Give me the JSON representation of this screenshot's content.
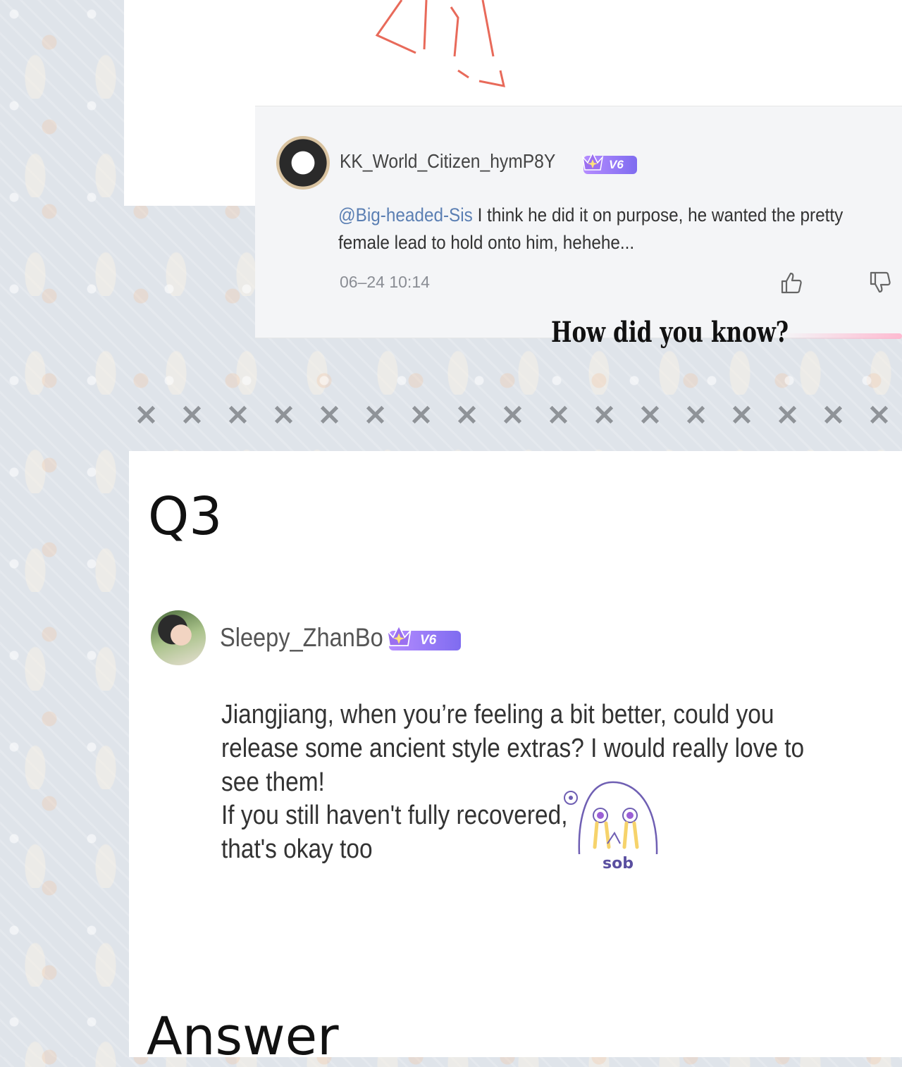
{
  "reply_comment": {
    "username": "KK_World_Citizen_hymP8Y",
    "level_badge": "V6",
    "mention": "@Big-headed-Sis",
    "text": " I think he did it on purpose, he wanted the pretty female lead to hold onto him, hehehe...",
    "timestamp": "06–24 10:14"
  },
  "caption": "How did you know?",
  "divider_marks": [
    "✕",
    "✕",
    "✕",
    "✕",
    "✕",
    "✕",
    "✕",
    "✕",
    "✕",
    "✕",
    "✕",
    "✕",
    "✕",
    "✕",
    "✕",
    "✕",
    "✕"
  ],
  "question": {
    "label": "Q3",
    "username": "Sleepy_ZhanBo",
    "level_badge": "V6",
    "paragraph1": "Jiangjiang, when you’re feeling a bit better, could you release some ancient style extras? I would really love to see them!",
    "paragraph2": "If you still haven't fully recovered, that's okay too",
    "sticker_text": "sob"
  },
  "answer_label": "Answer",
  "colors": {
    "mention": "#5b7fb3",
    "badge": "#8f72f3"
  }
}
